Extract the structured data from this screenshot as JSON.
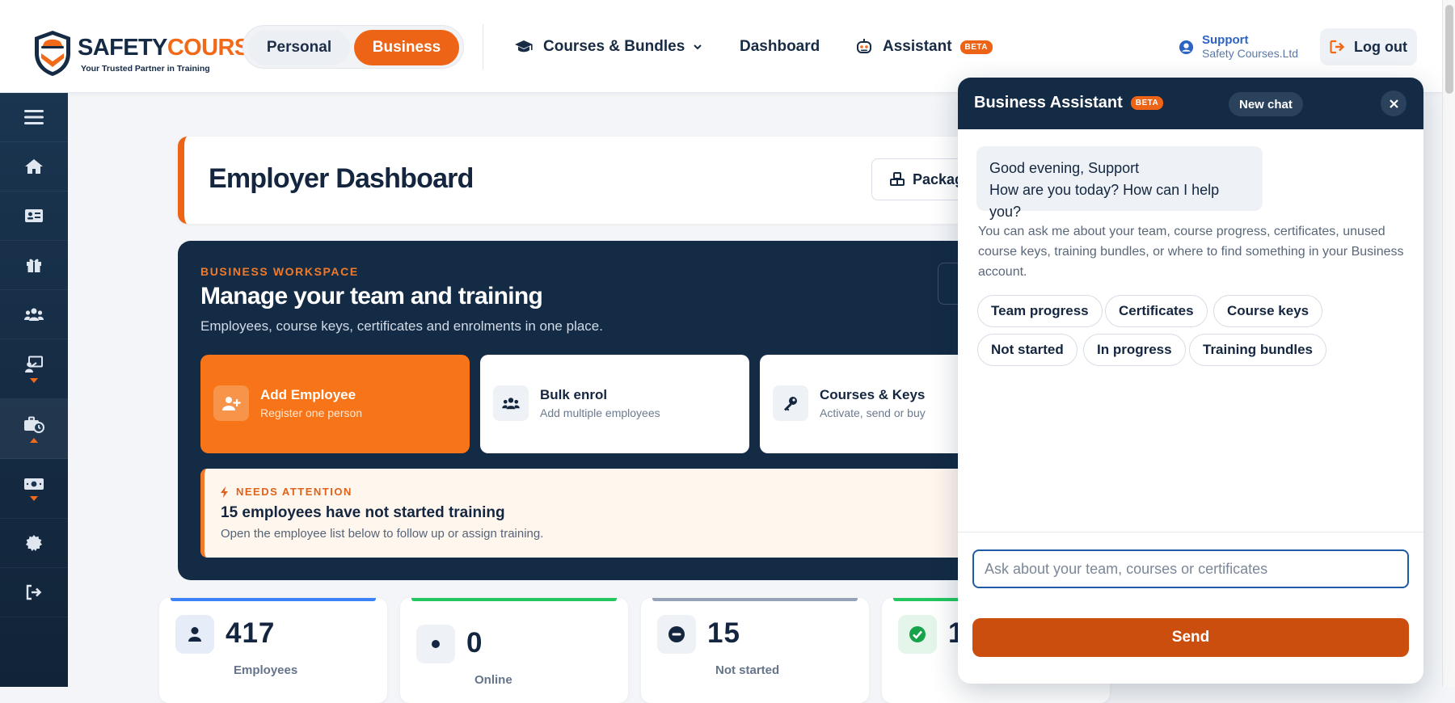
{
  "brand": {
    "name_part1": "SAFETY",
    "name_part2": "COURSES",
    "tagline": "Your Trusted Partner in Training",
    "accent": "#ee6416",
    "navy": "#132b45"
  },
  "header": {
    "mode_personal": "Personal",
    "mode_business": "Business",
    "active_mode": "Business",
    "nav": {
      "courses": "Courses & Bundles",
      "dashboard": "Dashboard",
      "assistant": "Assistant",
      "assistant_badge": "BETA"
    },
    "user": {
      "name": "Support",
      "org": "Safety Courses.Ltd"
    },
    "logout": "Log out"
  },
  "sidebar": {
    "items": [
      {
        "icon": "menu-icon"
      },
      {
        "icon": "home-icon"
      },
      {
        "icon": "id-card-icon"
      },
      {
        "icon": "gift-icon"
      },
      {
        "icon": "users-icon"
      },
      {
        "icon": "teacher-icon",
        "caret": "down"
      },
      {
        "icon": "business-clock-icon",
        "caret": "up",
        "active": true
      },
      {
        "icon": "money-icon",
        "caret": "down"
      },
      {
        "icon": "settings-badge-icon"
      },
      {
        "icon": "sign-out-icon"
      }
    ]
  },
  "main": {
    "page_title": "Employer Dashboard",
    "packages_button": "Package",
    "workspace": {
      "kicker": "BUSINESS WORKSPACE",
      "title": "Manage your team and training",
      "subtitle": "Employees, course keys, certificates and enrolments in one place."
    },
    "actions": [
      {
        "title": "Add Employee",
        "subtitle": "Register one person"
      },
      {
        "title": "Bulk enrol",
        "subtitle": "Add multiple employees"
      },
      {
        "title": "Courses & Keys",
        "subtitle": "Activate, send or buy"
      }
    ],
    "attention": {
      "kicker": "NEEDS ATTENTION",
      "title": "15 employees have not started training",
      "subtitle": "Open the employee list below to follow up or assign training."
    },
    "stats": [
      {
        "value": "417",
        "label": "Employees",
        "color": "#3b82f6"
      },
      {
        "value": "0",
        "label": "Online",
        "color": "#22c55e"
      },
      {
        "value": "15",
        "label": "Not started",
        "color": "#94a3b8"
      },
      {
        "value": "1",
        "label": "",
        "color": "#22c55e"
      }
    ]
  },
  "assistant": {
    "title": "Business Assistant",
    "badge": "BETA",
    "new_chat": "New chat",
    "greeting_line1": "Good evening, Support",
    "greeting_line2": "How are you today? How can I help you?",
    "info": "You can ask me about your team, course progress, certificates, unused course keys, training bundles, or where to find something in your Business account.",
    "chips": [
      "Team progress",
      "Certificates",
      "Course keys",
      "Not started",
      "In progress",
      "Training bundles"
    ],
    "input_placeholder": "Ask about your team, courses or certificates",
    "send": "Send"
  }
}
